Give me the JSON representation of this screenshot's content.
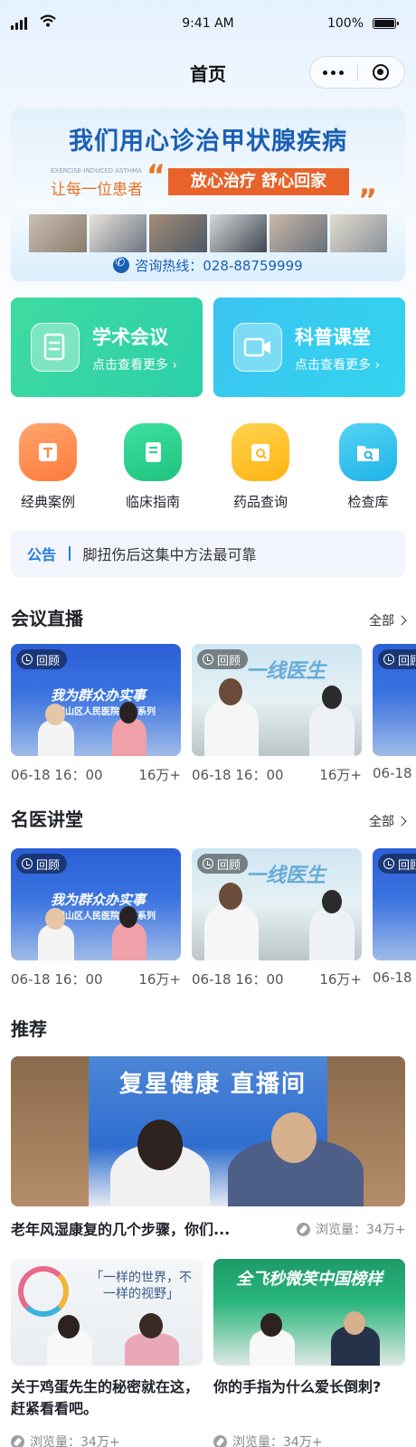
{
  "status_bar": {
    "time": "9:41 AM",
    "battery": "100%"
  },
  "nav": {
    "title": "首页"
  },
  "banner": {
    "title": "我们用心诊治甲状腺疾病",
    "subtitle_en": "EXERCISE-INDUCED ASTHMA",
    "left_text": "让每一位患者",
    "slogan": "放心治疗 舒心回家",
    "quote_open": "“",
    "quote_close": "”",
    "hotline": "咨询热线：028-88759999"
  },
  "features": [
    {
      "title": "学术会议",
      "subtitle": "点击查看更多 ›",
      "icon": "document-icon"
    },
    {
      "title": "科普课堂",
      "subtitle": "点击查看更多 ›",
      "icon": "video-icon"
    }
  ],
  "grid": [
    {
      "label": "经典案例",
      "icon": "scroll-icon",
      "color": "#ff8a4c"
    },
    {
      "label": "临床指南",
      "icon": "book-icon",
      "color": "#2fd492"
    },
    {
      "label": "药品查询",
      "icon": "calendar-search-icon",
      "color": "#ffc21f"
    },
    {
      "label": "检查库",
      "icon": "folder-search-icon",
      "color": "#33c3ef"
    }
  ],
  "notice": {
    "tag": "公告",
    "text": "脚扭伤后这集中方法最可靠"
  },
  "live": {
    "title": "会议直播",
    "all": "全部",
    "cards": [
      {
        "badge": "回顾",
        "date": "06-18 16：00",
        "views": "16万+",
        "headline": "我为群众办实事",
        "sub": "市璧山区人民医院大型系列"
      },
      {
        "badge": "回顾",
        "date": "06-18 16：00",
        "views": "16万+",
        "headline": "一线医生",
        "sub": ""
      },
      {
        "badge": "回顾",
        "date": "06-18 1",
        "views": "",
        "headline": "",
        "sub": ""
      }
    ]
  },
  "lecture": {
    "title": "名医讲堂",
    "all": "全部",
    "cards": [
      {
        "badge": "回顾",
        "date": "06-18 16：00",
        "views": "16万+",
        "headline": "我为群众办实事",
        "sub": "市璧山区人民医院大型系列"
      },
      {
        "badge": "回顾",
        "date": "06-18 16：00",
        "views": "16万+",
        "headline": "一线医生",
        "sub": ""
      },
      {
        "badge": "回顾",
        "date": "06-18 1",
        "views": "",
        "headline": "",
        "sub": ""
      }
    ]
  },
  "recommend": {
    "title": "推荐",
    "big": {
      "title": "老年风湿康复的几个步骤，你们...",
      "views": "浏览量：34万+",
      "overlay": "复星健康 直播间"
    },
    "small": [
      {
        "title": "关于鸡蛋先生的秘密就在这，赶紧看看吧。",
        "views": "浏览量：34万+",
        "overlay": "「一样的世界，不一样的视野」"
      },
      {
        "title": "你的手指为什么爱长倒刺?",
        "views": "浏览量：34万+",
        "overlay": "全飞秒微笑中国榜样"
      }
    ]
  }
}
